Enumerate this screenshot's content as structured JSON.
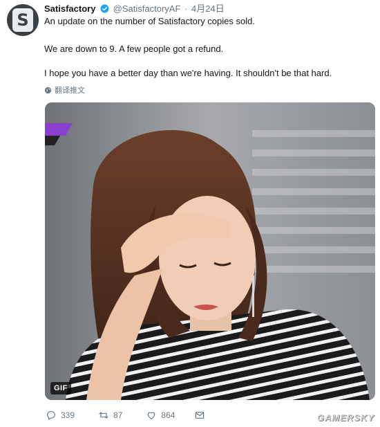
{
  "tweet": {
    "author_name": "Satisfactory",
    "handle": "@SatisfactoryAF",
    "separator": "·",
    "date": "4月24日",
    "lines": [
      "An update on the number of Satisfactory copies sold.",
      "We are down to 9. A few people got a refund.",
      "I hope you have a better day than we're having. It shouldn't be that hard."
    ],
    "translate_label": "翻译推文",
    "media_badge": "GIF",
    "counts": {
      "replies": "339",
      "retweets": "87",
      "likes": "864"
    }
  },
  "icons": [
    "verified-icon",
    "globe-icon",
    "reply-icon",
    "retweet-icon",
    "like-icon",
    "message-icon"
  ],
  "colors": {
    "accent": "#1da1f2",
    "muted": "#657786",
    "text": "#14171a"
  },
  "watermark": "GAMERSKY"
}
